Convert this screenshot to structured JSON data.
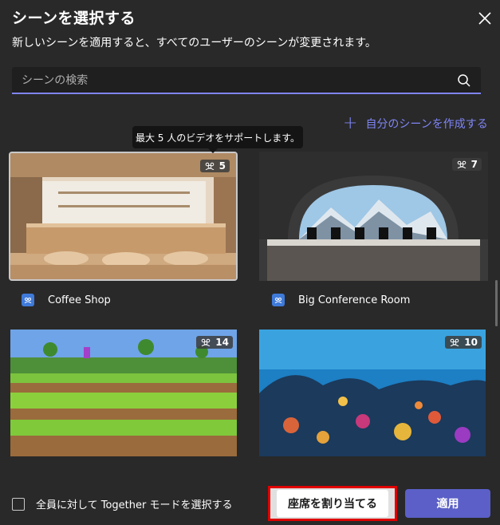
{
  "dialog": {
    "title": "シーンを選択する",
    "subtitle": "新しいシーンを適用すると、すべてのユーザーのシーンが変更されます。"
  },
  "search": {
    "placeholder": "シーンの検索"
  },
  "create_scene": {
    "label": "自分のシーンを作成する"
  },
  "tooltip": {
    "text": "最大 5 人のビデオをサポートします。"
  },
  "scenes": [
    {
      "name": "Coffee Shop",
      "capacity": "5",
      "selected": true
    },
    {
      "name": "Big Conference Room",
      "capacity": "7",
      "selected": false
    },
    {
      "name": "",
      "capacity": "14",
      "selected": false
    },
    {
      "name": "",
      "capacity": "10",
      "selected": false
    }
  ],
  "footer": {
    "checkbox_label": "全員に対して Together モードを選択する",
    "assign_seats_label": "座席を割り当てる",
    "apply_label": "適用"
  },
  "colors": {
    "background": "#292929",
    "accent": "#7f85f5",
    "primary_button": "#5b5fc7",
    "highlight_border": "#e00000"
  }
}
